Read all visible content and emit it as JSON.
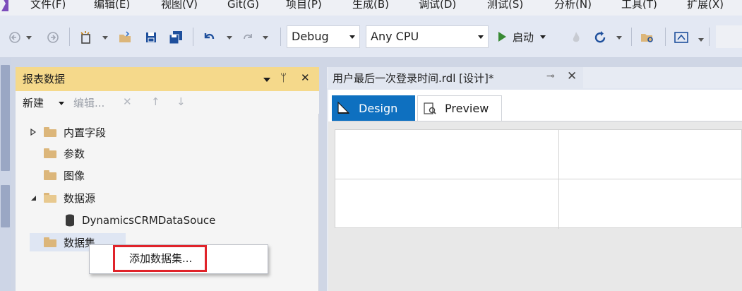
{
  "menu": {
    "items": [
      "文件(F)",
      "编辑(E)",
      "视图(V)",
      "Git(G)",
      "项目(P)",
      "生成(B)",
      "调试(D)",
      "测试(S)",
      "分析(N)",
      "工具(T)",
      "扩展(X)"
    ]
  },
  "toolbar": {
    "configuration": "Debug",
    "platform": "Any CPU",
    "start_label": "启动",
    "icons": [
      "back-icon",
      "forward-icon",
      "new-project-icon",
      "open-icon",
      "save-icon",
      "save-all-icon",
      "undo-icon",
      "redo-icon",
      "refresh-icon",
      "find-in-files-icon",
      "browser-icon"
    ]
  },
  "report_data_panel": {
    "title": "报表数据",
    "pin_glyph": "ᛘ",
    "close_glyph": "✕",
    "toolbar": {
      "new_label": "新建",
      "edit_label": "编辑...",
      "delete_glyph": "✕",
      "up_glyph": "↑",
      "down_glyph": "↓"
    },
    "tree": {
      "builtin_fields": "内置字段",
      "parameters": "参数",
      "images": "图像",
      "data_sources": "数据源",
      "data_source_item": "DynamicsCRMDataSouce",
      "datasets": "数据集"
    }
  },
  "context_menu": {
    "add_dataset": "添加数据集..."
  },
  "document": {
    "tab_title": "用户最后一次登录时间.rdl [设计]*",
    "pin_glyph": "⊸",
    "close_glyph": "✕",
    "design_tab": "Design",
    "preview_tab": "Preview"
  },
  "colors": {
    "panel_title_bg": "#f5d98b",
    "active_tab_bg": "#0e70c0",
    "highlight_border": "#e0232a",
    "start_green": "#388a34",
    "folder": "#dcb67a"
  }
}
